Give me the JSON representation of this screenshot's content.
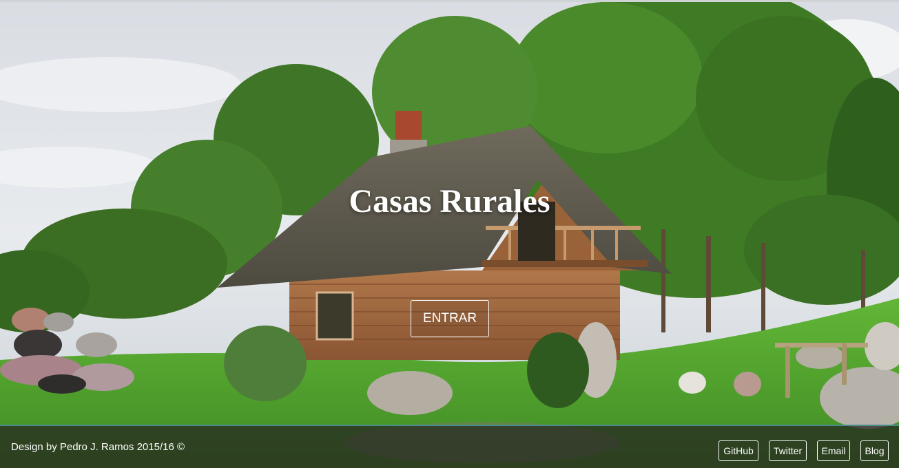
{
  "hero": {
    "title": "Casas Rurales",
    "enter_label": "ENTRAR"
  },
  "footer": {
    "credit": "Design by Pedro J. Ramos 2015/16 ©",
    "links": [
      {
        "label": "GitHub"
      },
      {
        "label": "Twitter"
      },
      {
        "label": "Email"
      },
      {
        "label": "Blog"
      }
    ]
  },
  "colors": {
    "text": "#ffffff",
    "footer_bg": "#262420",
    "footer_border": "#4a8c8a"
  }
}
